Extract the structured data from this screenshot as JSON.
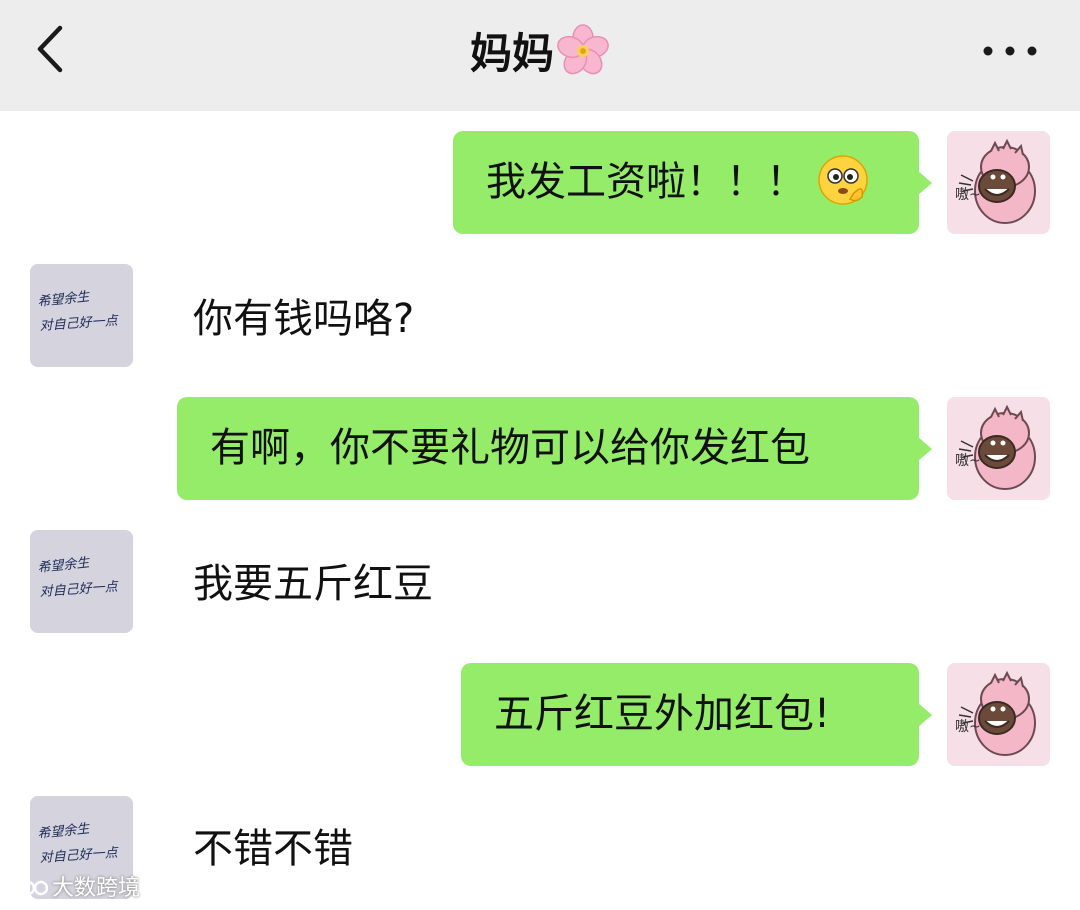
{
  "header": {
    "title": "妈妈",
    "back_icon": "chevron-left-icon",
    "more_icon": "more-dots-icon",
    "title_emoji": "cherry-blossom-icon",
    "background_color": "#ededed"
  },
  "messages": [
    {
      "sender": "me",
      "text": "我发工资啦！！！",
      "emoji": "saluting-face-icon"
    },
    {
      "sender": "mom",
      "text": "你有钱吗咯?"
    },
    {
      "sender": "me",
      "text": "有啊，你不要礼物可以给你发红包"
    },
    {
      "sender": "mom",
      "text": "我要五斤红豆"
    },
    {
      "sender": "me",
      "text": "五斤红豆外加红包!"
    },
    {
      "sender": "mom",
      "text": "不错不错"
    }
  ],
  "avatars": {
    "me_avatar_text": "嗷~",
    "mom_avatar_lines": [
      "希望余生",
      "对自己好一点"
    ]
  },
  "colors": {
    "outgoing_bubble": "#95ec69",
    "chat_background": "#ffffff"
  },
  "watermark": {
    "text": "大数跨境"
  }
}
